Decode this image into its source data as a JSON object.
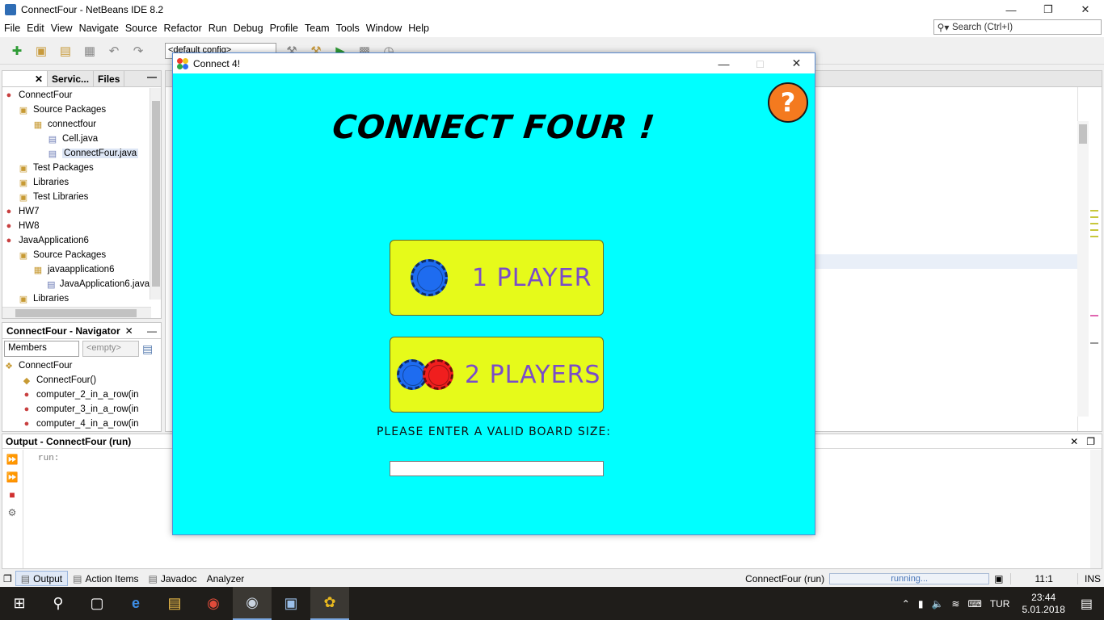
{
  "ide": {
    "title": "ConnectFour - NetBeans IDE 8.2",
    "menu": [
      "File",
      "Edit",
      "View",
      "Navigate",
      "Source",
      "Refactor",
      "Run",
      "Debug",
      "Profile",
      "Team",
      "Tools",
      "Window",
      "Help"
    ],
    "search_placeholder": "Search (Ctrl+I)",
    "config": "<default config>",
    "window_controls": [
      "minimize",
      "restore",
      "close"
    ]
  },
  "projects": {
    "tabs": [
      "Servic...",
      "Files"
    ],
    "tree": [
      {
        "label": "ConnectFour",
        "icon": "project-icon",
        "indent": 0
      },
      {
        "label": "Source Packages",
        "icon": "folder-icon",
        "indent": 1
      },
      {
        "label": "connectfour",
        "icon": "package-icon",
        "indent": 2
      },
      {
        "label": "Cell.java",
        "icon": "java-file-icon",
        "indent": 3
      },
      {
        "label": "ConnectFour.java",
        "icon": "java-file-icon",
        "indent": 3,
        "selected": true
      },
      {
        "label": "Test Packages",
        "icon": "folder-icon",
        "indent": 1
      },
      {
        "label": "Libraries",
        "icon": "folder-icon",
        "indent": 1
      },
      {
        "label": "Test Libraries",
        "icon": "folder-icon",
        "indent": 1
      },
      {
        "label": "HW7",
        "icon": "project-icon",
        "indent": 0
      },
      {
        "label": "HW8",
        "icon": "project-icon",
        "indent": 0
      },
      {
        "label": "JavaApplication6",
        "icon": "project-icon",
        "indent": 0
      },
      {
        "label": "Source Packages",
        "icon": "folder-icon",
        "indent": 1
      },
      {
        "label": "javaapplication6",
        "icon": "package-icon",
        "indent": 2
      },
      {
        "label": "JavaApplication6.java",
        "icon": "java-file-icon",
        "indent": 3
      },
      {
        "label": "Libraries",
        "icon": "folder-icon",
        "indent": 1
      }
    ]
  },
  "navigator": {
    "title": "ConnectFour - Navigator",
    "filter": "Members",
    "filter2": "<empty>",
    "items": [
      {
        "label": "ConnectFour",
        "icon": "class-icon",
        "indent": 0
      },
      {
        "label": "ConnectFour()",
        "icon": "constructor-icon",
        "indent": 1
      },
      {
        "label": "computer_2_in_a_row(in",
        "icon": "method-icon",
        "indent": 1
      },
      {
        "label": "computer_3_in_a_row(in",
        "icon": "method-icon",
        "indent": 1
      },
      {
        "label": "computer_4_in_a_row(in",
        "icon": "method-icon",
        "indent": 1
      }
    ]
  },
  "output": {
    "title": "Output - ConnectFour (run)",
    "text": "run:"
  },
  "bottom_tabs": [
    "Output",
    "Action Items",
    "Javadoc",
    "Analyzer"
  ],
  "status": {
    "run_label": "ConnectFour (run)",
    "progress_text": "running...",
    "position": "11:1",
    "mode": "INS"
  },
  "taskbar": {
    "apps": [
      "start-icon",
      "search-icon",
      "task-view-icon",
      "edge-icon",
      "explorer-icon",
      "chrome-icon",
      "steam-icon",
      "virtualbox-icon",
      "java-app-icon"
    ],
    "language": "TUR",
    "time": "23:44",
    "date": "5.01.2018"
  },
  "app": {
    "window_title": "Connect 4!",
    "title_text": "CONNECT FOUR !",
    "help_symbol": "?",
    "one_player_label": "1 PLAYER",
    "two_players_label": "2 PLAYERS",
    "prompt": "PLEASE ENTER A VALID BOARD SIZE:",
    "board_size_value": "",
    "colors": {
      "background": "#00ffff",
      "button": "#e6fa1a",
      "button_text": "#7a4cc8",
      "help": "#f47a1f",
      "chip_blue": "#1e6cf0",
      "chip_red": "#f01e1e"
    }
  }
}
